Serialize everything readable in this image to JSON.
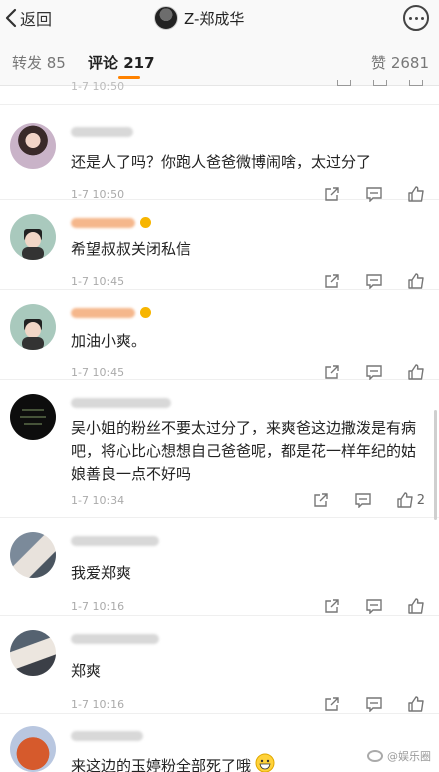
{
  "nav": {
    "back_label": "返回",
    "title": "Z-郑成华"
  },
  "tabs": {
    "forward_label": "转发 85",
    "comments_label": "评论 217",
    "likes_label": "赞 2681"
  },
  "list": {
    "partial_time": "1-7 10:50",
    "comments": [
      {
        "text": "还是人了吗？你跑人爸爸微博闹啥，太过分了",
        "time": "1-7 10:50",
        "likes": ""
      },
      {
        "text": "希望叔叔关闭私信",
        "time": "1-7 10:45",
        "likes": ""
      },
      {
        "text": "加油小爽。",
        "time": "1-7 10:45",
        "likes": ""
      },
      {
        "text": "吴小姐的粉丝不要太过分了，来爽爸这边撒泼是有病吧，将心比心想想自己爸爸呢，都是花一样年纪的姑娘善良一点不好吗",
        "time": "1-7 10:34",
        "likes": "2"
      },
      {
        "text": "我爱郑爽",
        "time": "1-7 10:16",
        "likes": ""
      },
      {
        "text": "郑爽",
        "time": "1-7 10:16",
        "likes": ""
      },
      {
        "text": "来这边的玉婷粉全部死了哦",
        "time": "",
        "likes": ""
      }
    ]
  },
  "icons": {
    "back": "chevron-left-icon",
    "more": "more-icon",
    "share": "share-icon",
    "reply": "comment-icon",
    "like": "thumbs-up-icon",
    "emoji": "grin-emoji-icon"
  },
  "colors": {
    "accent": "#ff8200",
    "nav_bg": "#f9f9f9",
    "text": "#222222",
    "muted": "#aaaaaa"
  },
  "watermark": "@娱乐圈"
}
